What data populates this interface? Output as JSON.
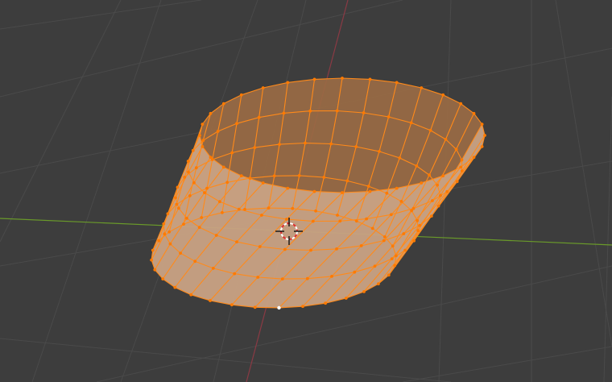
{
  "viewport": {
    "background": "#3d3d3d",
    "grid_color": "#4a4a4a",
    "x_axis_color": "#6a9a2a",
    "y_axis_color": "#8a3a44"
  },
  "mesh": {
    "object": "twisted-cylinder",
    "mode": "edit-mode-all-selected",
    "face_color": "#c9a284",
    "face_dark_color": "#a97e5c",
    "inner_color": "#9b6b45",
    "edge_color": "#ff8a1a",
    "vertex_color": "#ff7a00",
    "active_vertex_color": "#ffffff",
    "rings": 5,
    "segments": 32
  },
  "cursor": {
    "name": "3d-cursor-icon",
    "ring_colors": [
      "#ffffff",
      "#e03030"
    ]
  }
}
